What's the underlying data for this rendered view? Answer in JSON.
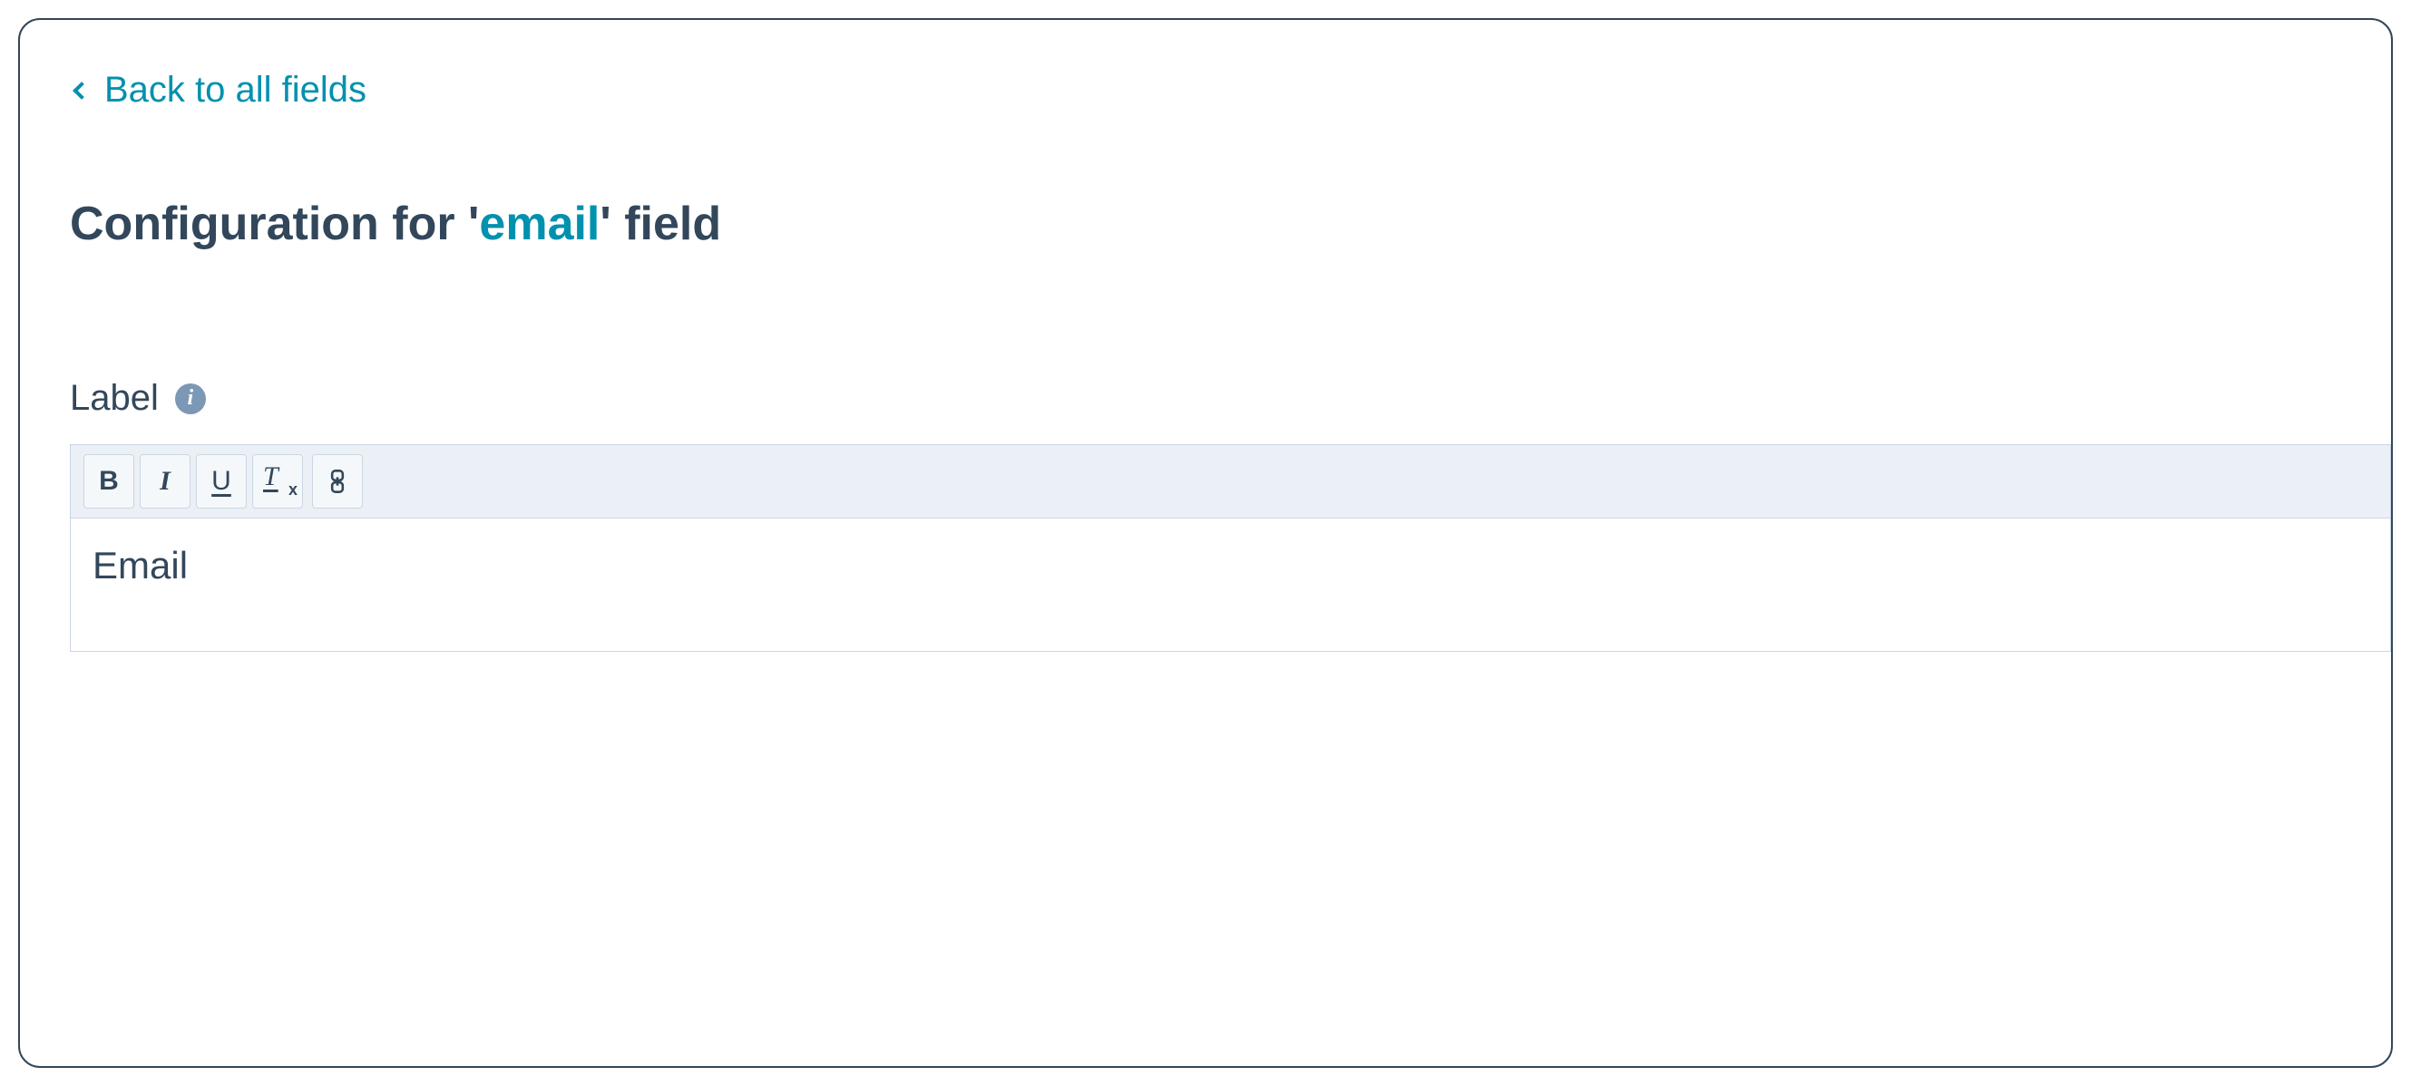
{
  "back_link": {
    "label": "Back to all fields"
  },
  "heading": {
    "prefix": "Configuration for '",
    "field_name": "email",
    "suffix": "' field"
  },
  "label_section": {
    "label": "Label",
    "info_glyph": "i"
  },
  "toolbar": {
    "bold": "B",
    "italic": "I",
    "underline": "U",
    "clear_t": "T",
    "clear_x": "x"
  },
  "editor": {
    "value": "Email"
  }
}
